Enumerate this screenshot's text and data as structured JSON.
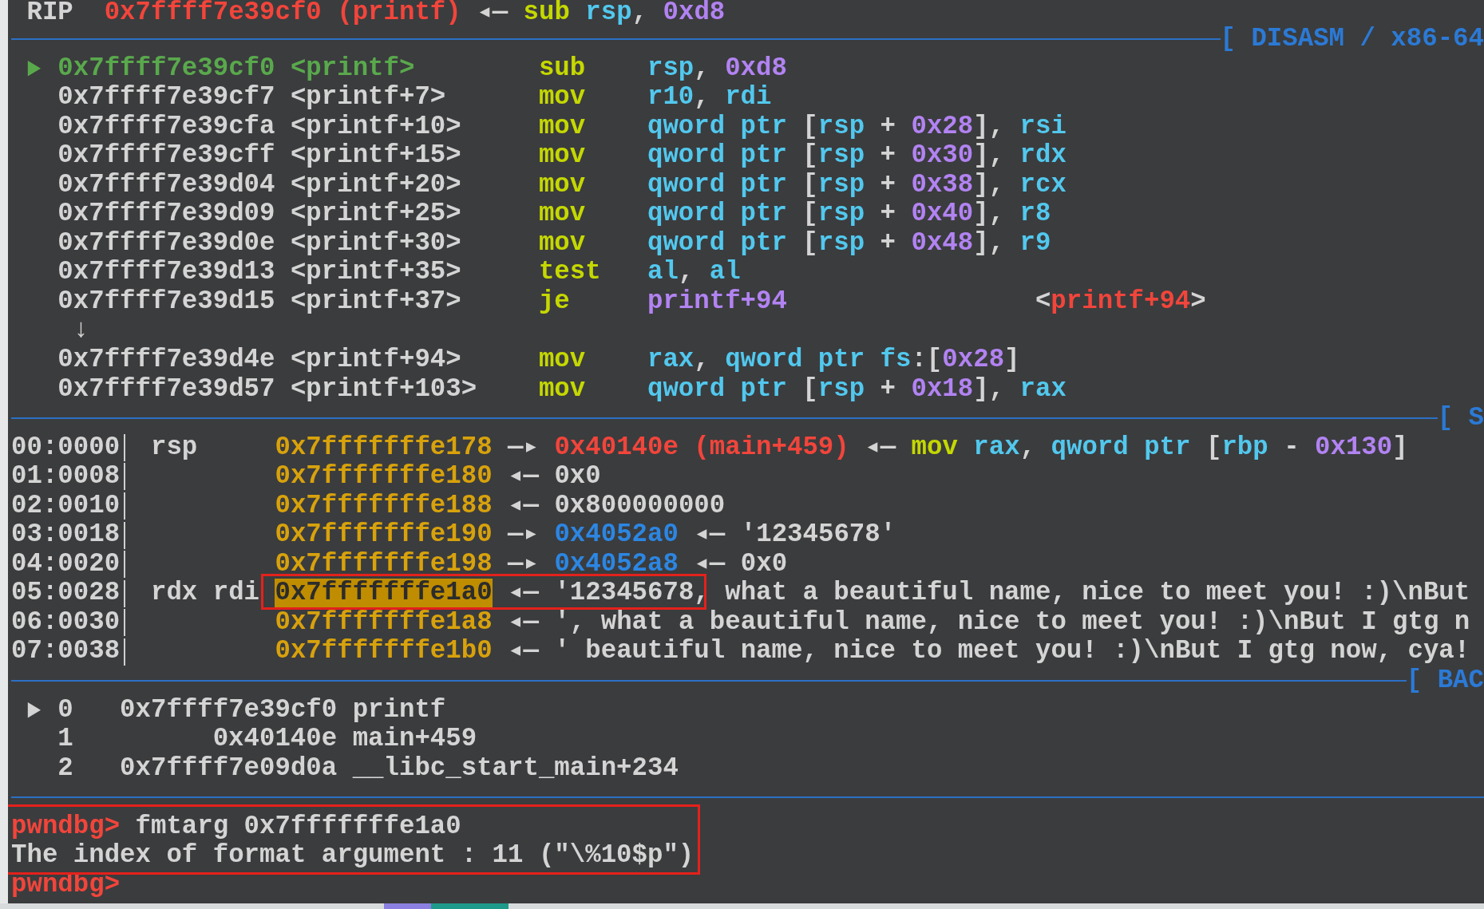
{
  "registers": [
    {
      "name": "RIP",
      "tokens": [
        {
          "kind": "code",
          "text": "0x7ffff7e39cf0 (printf)"
        },
        {
          "kind": "arrow",
          "text": "◂—"
        },
        {
          "kind": "mnemonic",
          "text": "sub"
        },
        {
          "kind": "register",
          "text": "rsp"
        },
        {
          "kind": "punct",
          "text": ",",
          "attached": true
        },
        {
          "kind": "immediate",
          "text": "0xd8"
        }
      ]
    }
  ],
  "disasm": {
    "title": "[ DISASM / x86-64",
    "lines": [
      {
        "kind": "instruction",
        "current": true,
        "address": "0x7ffff7e39cf0",
        "symbol": "<printf>",
        "mnemonic": "sub",
        "operands": [
          {
            "kind": "register",
            "text": "rsp"
          },
          {
            "kind": "punct",
            "text": ",",
            "attached": true
          },
          {
            "kind": "immediate",
            "text": "0xd8"
          }
        ]
      },
      {
        "kind": "instruction",
        "current": false,
        "address": "0x7ffff7e39cf7",
        "symbol": "<printf+7>",
        "mnemonic": "mov",
        "operands": [
          {
            "kind": "register",
            "text": "r10"
          },
          {
            "kind": "punct",
            "text": ",",
            "attached": true
          },
          {
            "kind": "register",
            "text": "rdi"
          }
        ]
      },
      {
        "kind": "instruction",
        "current": false,
        "address": "0x7ffff7e39cfa",
        "symbol": "<printf+10>",
        "mnemonic": "mov",
        "operands": [
          {
            "kind": "register",
            "text": "qword ptr"
          },
          {
            "kind": "punct",
            "text": "["
          },
          {
            "kind": "register",
            "text": "rsp",
            "attached": true
          },
          {
            "kind": "punct",
            "text": "+"
          },
          {
            "kind": "immediate",
            "text": "0x28"
          },
          {
            "kind": "punct",
            "text": "],",
            "attached": true
          },
          {
            "kind": "register",
            "text": "rsi"
          }
        ]
      },
      {
        "kind": "instruction",
        "current": false,
        "address": "0x7ffff7e39cff",
        "symbol": "<printf+15>",
        "mnemonic": "mov",
        "operands": [
          {
            "kind": "register",
            "text": "qword ptr"
          },
          {
            "kind": "punct",
            "text": "["
          },
          {
            "kind": "register",
            "text": "rsp",
            "attached": true
          },
          {
            "kind": "punct",
            "text": "+"
          },
          {
            "kind": "immediate",
            "text": "0x30"
          },
          {
            "kind": "punct",
            "text": "],",
            "attached": true
          },
          {
            "kind": "register",
            "text": "rdx"
          }
        ]
      },
      {
        "kind": "instruction",
        "current": false,
        "address": "0x7ffff7e39d04",
        "symbol": "<printf+20>",
        "mnemonic": "mov",
        "operands": [
          {
            "kind": "register",
            "text": "qword ptr"
          },
          {
            "kind": "punct",
            "text": "["
          },
          {
            "kind": "register",
            "text": "rsp",
            "attached": true
          },
          {
            "kind": "punct",
            "text": "+"
          },
          {
            "kind": "immediate",
            "text": "0x38"
          },
          {
            "kind": "punct",
            "text": "],",
            "attached": true
          },
          {
            "kind": "register",
            "text": "rcx"
          }
        ]
      },
      {
        "kind": "instruction",
        "current": false,
        "address": "0x7ffff7e39d09",
        "symbol": "<printf+25>",
        "mnemonic": "mov",
        "operands": [
          {
            "kind": "register",
            "text": "qword ptr"
          },
          {
            "kind": "punct",
            "text": "["
          },
          {
            "kind": "register",
            "text": "rsp",
            "attached": true
          },
          {
            "kind": "punct",
            "text": "+"
          },
          {
            "kind": "immediate",
            "text": "0x40"
          },
          {
            "kind": "punct",
            "text": "],",
            "attached": true
          },
          {
            "kind": "register",
            "text": "r8"
          }
        ]
      },
      {
        "kind": "instruction",
        "current": false,
        "address": "0x7ffff7e39d0e",
        "symbol": "<printf+30>",
        "mnemonic": "mov",
        "operands": [
          {
            "kind": "register",
            "text": "qword ptr"
          },
          {
            "kind": "punct",
            "text": "["
          },
          {
            "kind": "register",
            "text": "rsp",
            "attached": true
          },
          {
            "kind": "punct",
            "text": "+"
          },
          {
            "kind": "immediate",
            "text": "0x48"
          },
          {
            "kind": "punct",
            "text": "],",
            "attached": true
          },
          {
            "kind": "register",
            "text": "r9"
          }
        ]
      },
      {
        "kind": "instruction",
        "current": false,
        "address": "0x7ffff7e39d13",
        "symbol": "<printf+35>",
        "mnemonic": "test",
        "operands": [
          {
            "kind": "register",
            "text": "al"
          },
          {
            "kind": "punct",
            "text": ",",
            "attached": true
          },
          {
            "kind": "register",
            "text": "al"
          }
        ]
      },
      {
        "kind": "instruction",
        "current": false,
        "address": "0x7ffff7e39d15",
        "symbol": "<printf+37>",
        "mnemonic": "je",
        "operands": [
          {
            "kind": "immediate",
            "text": "printf+94"
          }
        ],
        "target": {
          "open": "<",
          "symbol": "printf+94",
          "close": ">"
        }
      },
      {
        "kind": "jump",
        "text": "↓"
      },
      {
        "kind": "instruction",
        "current": false,
        "address": "0x7ffff7e39d4e",
        "symbol": "<printf+94>",
        "mnemonic": "mov",
        "operands": [
          {
            "kind": "register",
            "text": "rax"
          },
          {
            "kind": "punct",
            "text": ",",
            "attached": true
          },
          {
            "kind": "register",
            "text": "qword ptr fs"
          },
          {
            "kind": "punct",
            "text": ":[",
            "attached": true
          },
          {
            "kind": "immediate",
            "text": "0x28",
            "attached": true
          },
          {
            "kind": "punct",
            "text": "]",
            "attached": true
          }
        ]
      },
      {
        "kind": "instruction",
        "current": false,
        "address": "0x7ffff7e39d57",
        "symbol": "<printf+103>",
        "mnemonic": "mov",
        "operands": [
          {
            "kind": "register",
            "text": "qword ptr"
          },
          {
            "kind": "punct",
            "text": "["
          },
          {
            "kind": "register",
            "text": "rsp",
            "attached": true
          },
          {
            "kind": "punct",
            "text": "+"
          },
          {
            "kind": "immediate",
            "text": "0x18"
          },
          {
            "kind": "punct",
            "text": "],",
            "attached": true
          },
          {
            "kind": "register",
            "text": "rax"
          }
        ]
      }
    ]
  },
  "stack": {
    "title": "[ S",
    "rows": [
      {
        "index": "00:0000",
        "registers": "rsp",
        "address": "0x7fffffffe178",
        "highlighted": false,
        "annotated": false,
        "tokens": [
          {
            "kind": "arrow",
            "text": "—▸"
          },
          {
            "kind": "code",
            "text": "0x40140e (main+459)"
          },
          {
            "kind": "arrow",
            "text": "◂—"
          },
          {
            "kind": "mnemonic",
            "text": "mov"
          },
          {
            "kind": "register",
            "text": "rax"
          },
          {
            "kind": "punct",
            "text": ",",
            "attached": true
          },
          {
            "kind": "register",
            "text": "qword ptr"
          },
          {
            "kind": "punct",
            "text": "["
          },
          {
            "kind": "register",
            "text": "rbp",
            "attached": true
          },
          {
            "kind": "punct",
            "text": "-"
          },
          {
            "kind": "immediate",
            "text": "0x130"
          },
          {
            "kind": "punct",
            "text": "]",
            "attached": true
          }
        ]
      },
      {
        "index": "01:0008",
        "address": "0x7fffffffe180",
        "highlighted": false,
        "annotated": false,
        "tokens": [
          {
            "kind": "arrow",
            "text": "◂—"
          },
          {
            "kind": "plain",
            "text": "0x0"
          }
        ]
      },
      {
        "index": "02:0010",
        "address": "0x7fffffffe188",
        "highlighted": false,
        "annotated": false,
        "tokens": [
          {
            "kind": "arrow",
            "text": "◂—"
          },
          {
            "kind": "plain",
            "text": "0x800000000"
          }
        ]
      },
      {
        "index": "03:0018",
        "address": "0x7fffffffe190",
        "highlighted": false,
        "annotated": false,
        "tokens": [
          {
            "kind": "arrow",
            "text": "—▸"
          },
          {
            "kind": "heap",
            "text": "0x4052a0"
          },
          {
            "kind": "arrow",
            "text": "◂—"
          },
          {
            "kind": "plain",
            "text": "'12345678'"
          }
        ]
      },
      {
        "index": "04:0020",
        "address": "0x7fffffffe198",
        "highlighted": false,
        "annotated": false,
        "tokens": [
          {
            "kind": "arrow",
            "text": "—▸"
          },
          {
            "kind": "heap",
            "text": "0x4052a8"
          },
          {
            "kind": "arrow",
            "text": "◂—"
          },
          {
            "kind": "plain",
            "text": "0x0"
          }
        ]
      },
      {
        "index": "05:0028",
        "registers": "rdx rdi",
        "address": "0x7fffffffe1a0",
        "highlighted": true,
        "annotated": true,
        "tokens": [
          {
            "kind": "arrow",
            "text": "◂—"
          },
          {
            "kind": "plain",
            "text": "'12345678, what a beautiful name, nice to meet you! :)\\nBut"
          }
        ]
      },
      {
        "index": "06:0030",
        "address": "0x7fffffffe1a8",
        "highlighted": false,
        "annotated": false,
        "tokens": [
          {
            "kind": "arrow",
            "text": "◂—"
          },
          {
            "kind": "plain",
            "text": "', what a beautiful name, nice to meet you! :)\\nBut I gtg n"
          }
        ]
      },
      {
        "index": "07:0038",
        "address": "0x7fffffffe1b0",
        "highlighted": false,
        "annotated": false,
        "tokens": [
          {
            "kind": "arrow",
            "text": "◂—"
          },
          {
            "kind": "plain",
            "text": "' beautiful name, nice to meet you! :)\\nBut I gtg now, cya!"
          }
        ]
      }
    ]
  },
  "backtrace": {
    "title": "[ BAC",
    "frames": [
      {
        "current": true,
        "index": "0",
        "address": "0x7ffff7e39cf0",
        "symbol": "printf"
      },
      {
        "current": false,
        "index": "1",
        "address": "0x40140e",
        "symbol": "main+459"
      },
      {
        "current": false,
        "index": "2",
        "address": "0x7ffff7e09d0a",
        "symbol": "__libc_start_main+234"
      }
    ]
  },
  "console": {
    "lines": [
      {
        "kind": "command",
        "annotated": true,
        "prompt": "pwndbg>",
        "text": "fmtarg 0x7fffffffe1a0"
      },
      {
        "kind": "output",
        "annotated": true,
        "text": "The index of format argument : 11 (\"\\%10$p\")"
      },
      {
        "kind": "command",
        "annotated": false,
        "prompt": "pwndbg>"
      }
    ]
  }
}
